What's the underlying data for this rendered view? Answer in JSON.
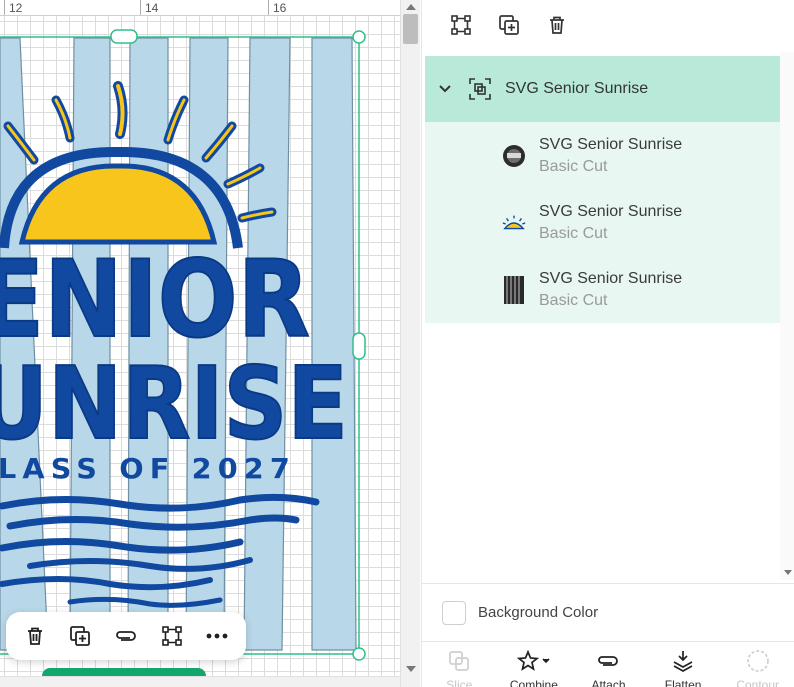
{
  "ruler": {
    "marks": [
      "12",
      "14",
      "16"
    ]
  },
  "design": {
    "lines": [
      "ENIOR",
      "UNRISE",
      "LASS OF 2027"
    ],
    "colors": {
      "stripe": "#b8d8ea",
      "blue": "#1149a0",
      "yellow": "#f7c51b",
      "selection": "#2fc089"
    }
  },
  "canvas_toolbar": {
    "items": [
      {
        "name": "delete",
        "icon": "trash-icon"
      },
      {
        "name": "duplicate",
        "icon": "duplicate-icon"
      },
      {
        "name": "attach",
        "icon": "paperclip-icon"
      },
      {
        "name": "group",
        "icon": "group-icon"
      },
      {
        "name": "more",
        "icon": "more-icon"
      }
    ]
  },
  "panel": {
    "top_toolbar": [
      {
        "name": "group",
        "icon": "group-icon"
      },
      {
        "name": "duplicate",
        "icon": "duplicate-icon"
      },
      {
        "name": "delete",
        "icon": "trash-icon"
      }
    ],
    "group": {
      "title": "SVG Senior Sunrise",
      "expanded": true
    },
    "layers": [
      {
        "name": "SVG Senior Sunrise",
        "type": "Basic Cut",
        "thumb": "badge-thumbnail"
      },
      {
        "name": "SVG Senior Sunrise",
        "type": "Basic Cut",
        "thumb": "sun-thumbnail"
      },
      {
        "name": "SVG Senior Sunrise",
        "type": "Basic Cut",
        "thumb": "stripes-thumbnail"
      }
    ],
    "background_color_label": "Background Color",
    "actions": [
      {
        "label": "Slice",
        "icon": "slice-icon",
        "enabled": false
      },
      {
        "label": "Combine",
        "icon": "combine-icon",
        "enabled": true
      },
      {
        "label": "Attach",
        "icon": "paperclip-icon",
        "enabled": true
      },
      {
        "label": "Flatten",
        "icon": "flatten-icon",
        "enabled": true
      },
      {
        "label": "Contour",
        "icon": "contour-icon",
        "enabled": false
      }
    ]
  }
}
